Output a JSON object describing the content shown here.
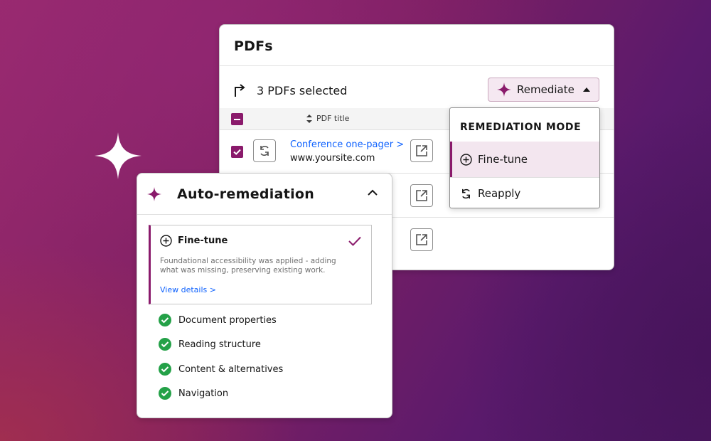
{
  "pdfs_panel": {
    "title": "PDFs",
    "selection_text": "3 PDFs selected",
    "remediate_label": "Remediate",
    "column_header": "PDF title",
    "rows": [
      {
        "title": "Conference one-pager >",
        "url": "www.yoursite.com"
      }
    ]
  },
  "remediation_menu": {
    "title": "REMEDIATION MODE",
    "items": [
      {
        "label": "Fine-tune",
        "icon": "add-circle-icon",
        "selected": true
      },
      {
        "label": "Reapply",
        "icon": "renew-icon",
        "selected": false
      }
    ]
  },
  "auto_panel": {
    "title": "Auto-remediation",
    "card": {
      "title": "Fine-tune",
      "description": "Foundational accessibility was applied - adding what was missing, preserving existing work.",
      "link": "View details >"
    },
    "checks": [
      "Document properties",
      "Reading structure",
      "Content & alternatives",
      "Navigation"
    ]
  },
  "colors": {
    "accent": "#8a1a6b",
    "link": "#0f62fe",
    "success": "#24a148"
  }
}
